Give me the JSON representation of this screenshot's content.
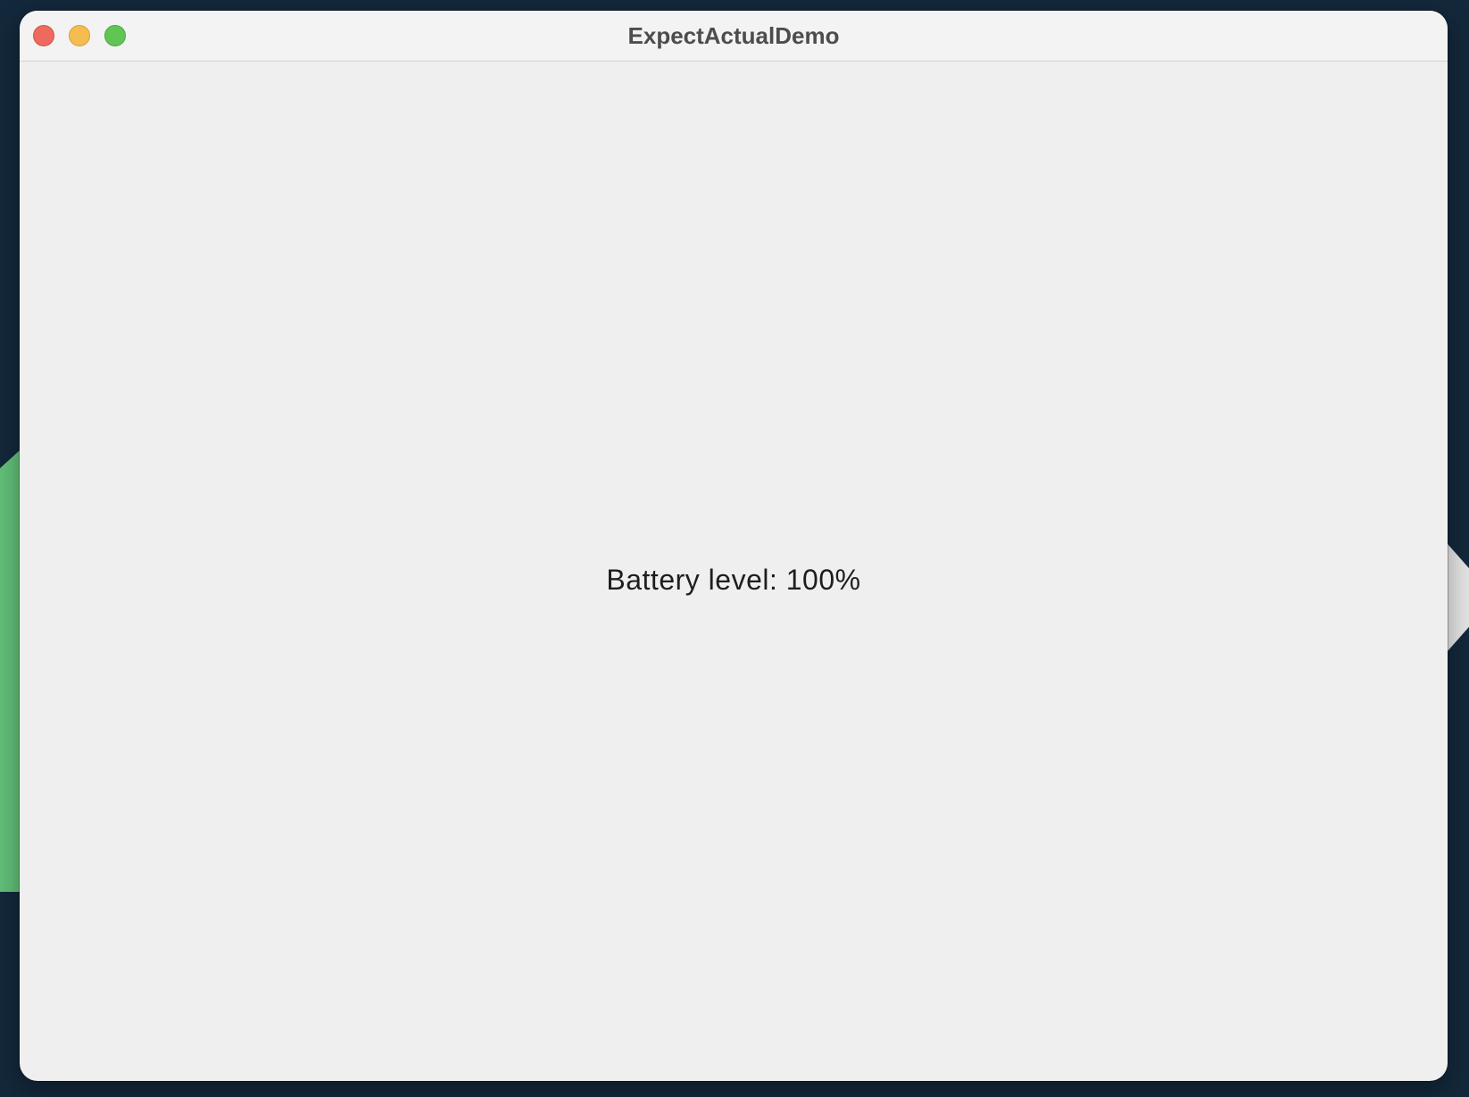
{
  "window": {
    "title": "ExpectActualDemo",
    "controls": {
      "close_icon": "close-icon",
      "minimize_icon": "minimize-icon",
      "zoom_icon": "zoom-icon"
    }
  },
  "main": {
    "battery_text": "Battery level: 100%"
  },
  "colors": {
    "close": "#ee6a5f",
    "minimize": "#f5bd4f",
    "zoom": "#61c554",
    "window_bg": "#efefef",
    "desktop_bg": "#13283b"
  }
}
